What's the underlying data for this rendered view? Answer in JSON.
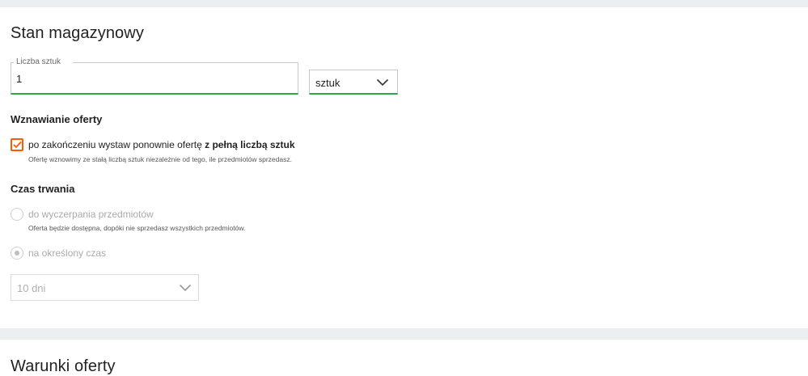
{
  "stock": {
    "title": "Stan magazynowy",
    "quantity": {
      "label": "Liczba sztuk",
      "value": "1"
    },
    "unit": {
      "selected": "sztuk"
    },
    "renewal": {
      "title": "Wznawianie oferty",
      "checked": true,
      "label_prefix": "po zakończeniu wystaw ponownie ofertę",
      "label_bold": "z pełną liczbą sztuk",
      "hint": "Ofertę wznowimy ze stałą liczbą sztuk niezależnie od tego, ile przedmiotów sprzedasz."
    },
    "duration": {
      "title": "Czas trwania",
      "options": [
        {
          "label": "do wyczerpania przedmiotów",
          "hint": "Oferta będzie dostępna, dopóki nie sprzedasz wszystkich przedmiotów.",
          "selected": false
        },
        {
          "label": "na określony czas",
          "selected": true
        }
      ],
      "select_value": "10 dni"
    }
  },
  "terms": {
    "title": "Warunki oferty"
  },
  "colors": {
    "accent_orange": "#ff5a00",
    "focus_green": "#2ea84a",
    "page_background": "#eceff1"
  }
}
